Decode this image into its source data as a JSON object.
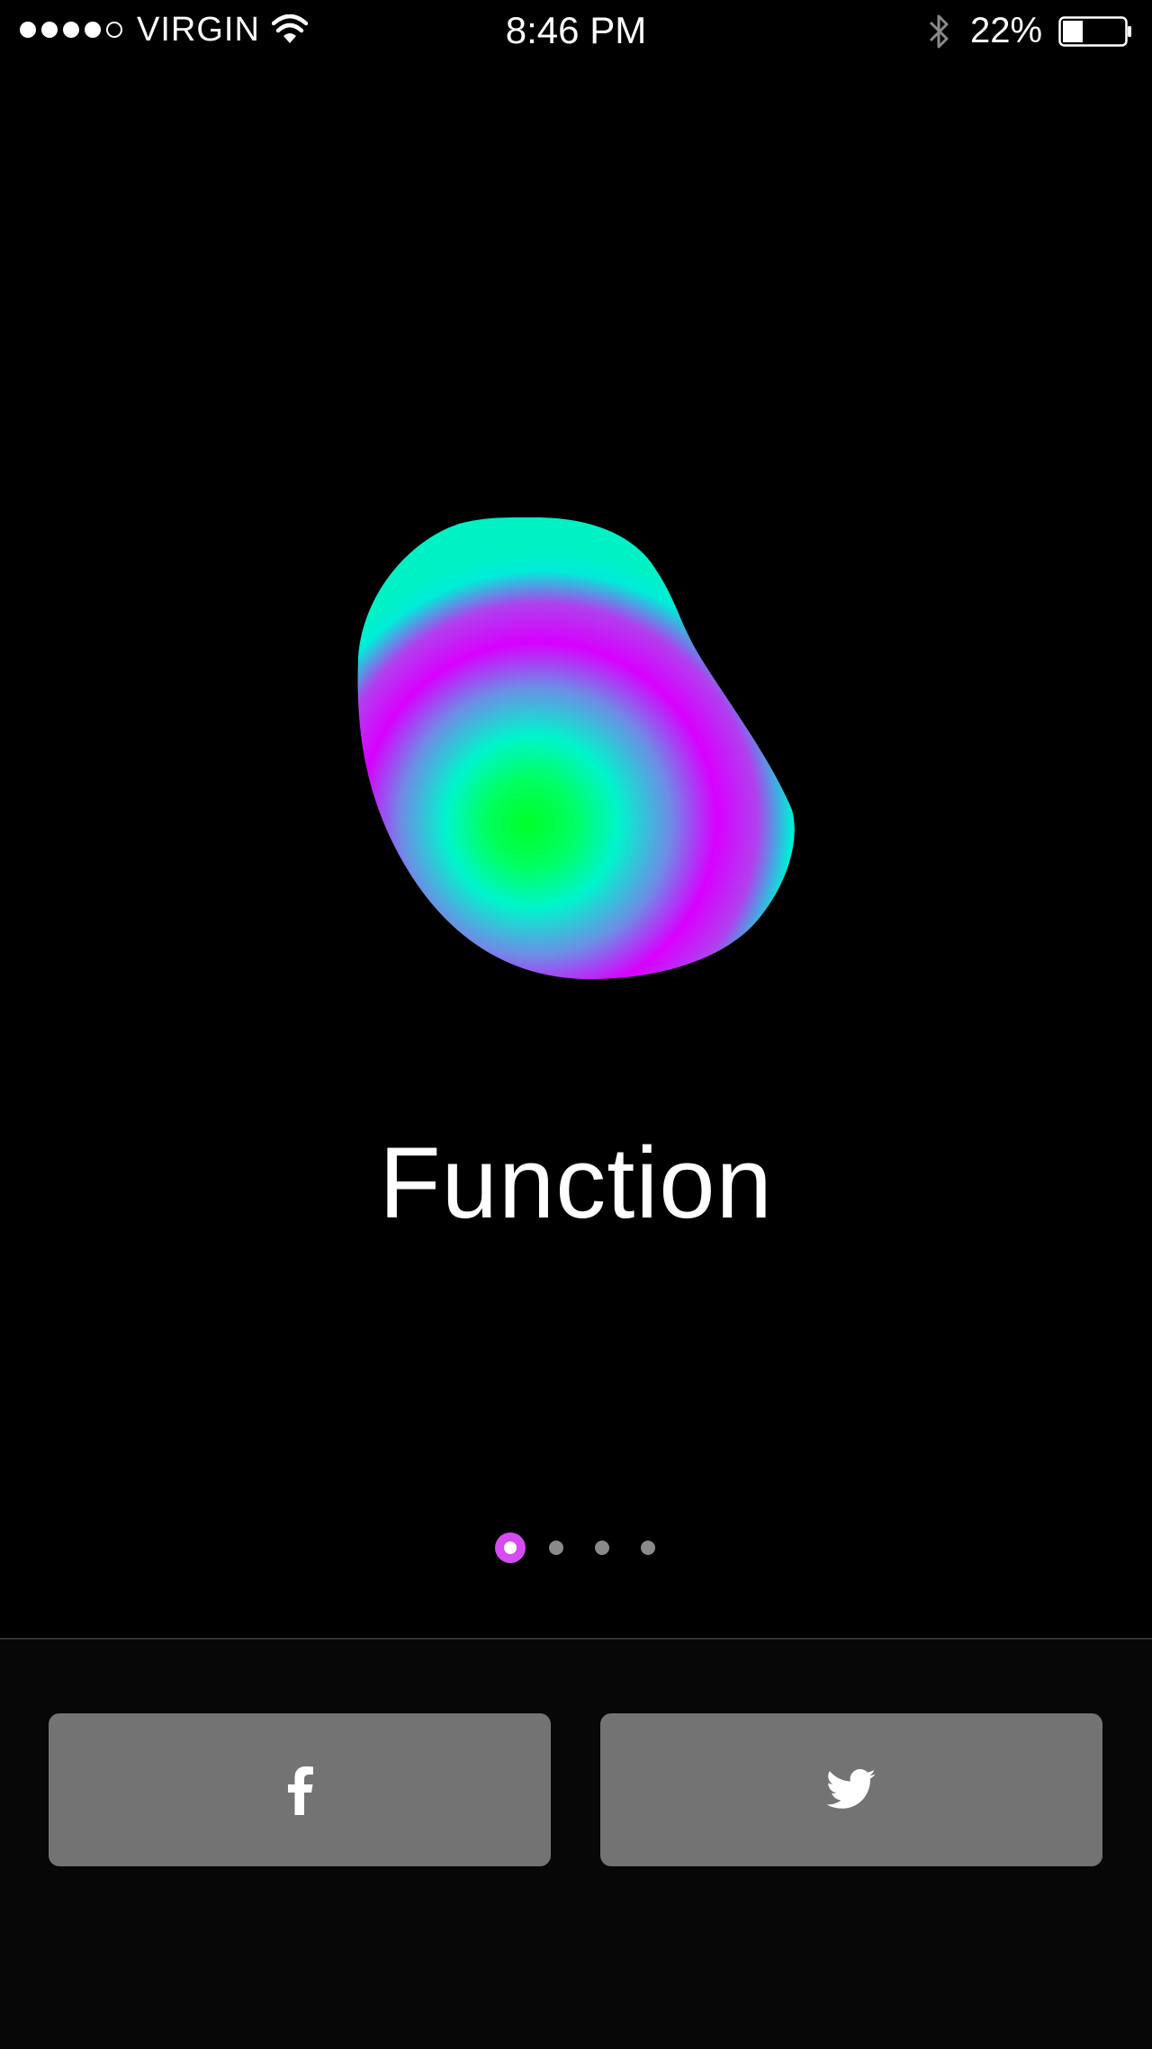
{
  "status_bar": {
    "signal_strength": 4,
    "signal_total": 5,
    "carrier": "VIRGIN",
    "time": "8:46 PM",
    "battery_percent": "22%",
    "battery_level": 0.22,
    "icons": [
      "wifi-icon",
      "bluetooth-icon",
      "battery-icon"
    ]
  },
  "onboarding": {
    "title": "Function",
    "logo_icon": "gradient-blob-logo",
    "logo_colors": [
      "#00ff30",
      "#00f5c8",
      "#d000ff",
      "#00f0c0"
    ],
    "page_count": 4,
    "active_page": 1,
    "accent_color": "#d54cf0"
  },
  "login": {
    "buttons": [
      {
        "id": "facebook",
        "icon": "facebook-icon"
      },
      {
        "id": "twitter",
        "icon": "twitter-icon"
      }
    ],
    "button_color": "#737373"
  }
}
